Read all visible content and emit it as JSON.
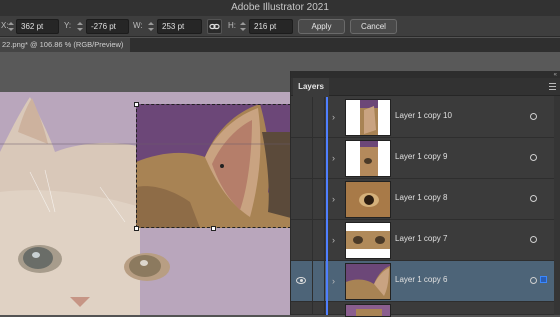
{
  "app": {
    "title": "Adobe Illustrator 2021"
  },
  "controls": {
    "x_label": "X:",
    "x_value": "362 pt",
    "y_label": "Y:",
    "y_value": "-276 pt",
    "w_label": "W:",
    "w_value": "253 pt",
    "h_label": "H:",
    "h_value": "216 pt",
    "apply_label": "Apply",
    "cancel_label": "Cancel"
  },
  "document_tab": {
    "title": "22.png* @ 106.86 % (RGB/Preview)"
  },
  "layers_panel": {
    "tab_label": "Layers",
    "layers": [
      {
        "name": "Layer 1 copy 10",
        "visible": false,
        "selected": false
      },
      {
        "name": "Layer 1 copy 9",
        "visible": false,
        "selected": false
      },
      {
        "name": "Layer 1 copy 8",
        "visible": false,
        "selected": false
      },
      {
        "name": "Layer 1 copy 7",
        "visible": false,
        "selected": false
      },
      {
        "name": "Layer 1 copy 6",
        "visible": true,
        "selected": true
      }
    ]
  },
  "colors": {
    "layer_color": "#4f7fff",
    "selected_row": "#4d6478",
    "panel_bg": "#3b3b3b"
  },
  "icons": [
    "link-icon",
    "eye-icon",
    "chevron-right-icon",
    "target-icon",
    "panel-menu-icon",
    "collapse-icon"
  ]
}
